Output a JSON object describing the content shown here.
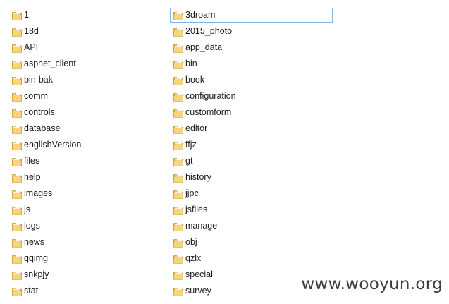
{
  "folders_left": [
    "1",
    "18d",
    "API",
    "aspnet_client",
    "bin-bak",
    "comm",
    "controls",
    "database",
    "englishVersion",
    "files",
    "help",
    "images",
    "js",
    "logs",
    "news",
    "qqimg",
    "snkpjy",
    "stat"
  ],
  "folders_right": [
    "3droam",
    "2015_photo",
    "app_data",
    "bin",
    "book",
    "configuration",
    "customform",
    "editor",
    "ffjz",
    "gt",
    "history",
    "jjpc",
    "jsfiles",
    "manage",
    "obj",
    "qzlx",
    "special",
    "survey"
  ],
  "selected_folder": "3droam",
  "icon": "folder-icon",
  "colors": {
    "folder_light": "#f5d67a",
    "folder_dark": "#d9a928",
    "selection_border": "#7eb4ea"
  },
  "watermark": "www.wooyun.org"
}
